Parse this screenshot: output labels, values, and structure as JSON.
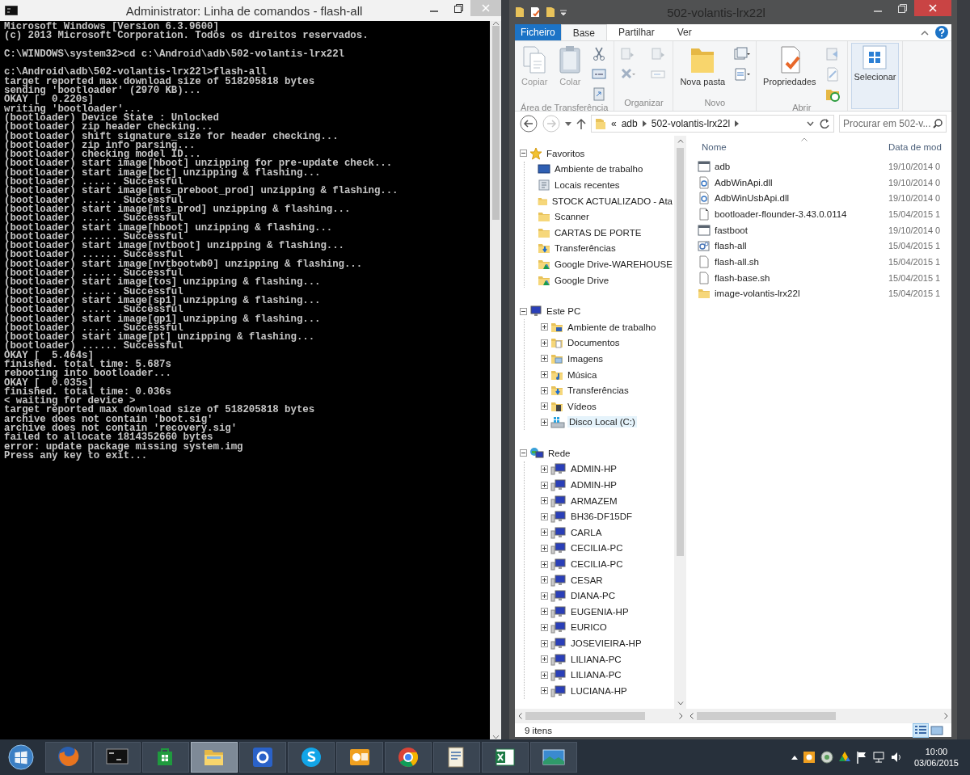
{
  "console": {
    "title": "Administrator: Linha de comandos - flash-all",
    "blocks": [
      [
        "Microsoft Windows [Version 6.3.9600]",
        "(c) 2013 Microsoft Corporation. Todos os direitos reservados."
      ],
      [
        "C:\\WINDOWS\\system32>cd c:\\Android\\adb\\502-volantis-lrx22l"
      ],
      [
        "c:\\Android\\adb\\502-volantis-lrx22l>flash-all",
        "target reported max download size of 518205818 bytes",
        "sending 'bootloader' (2970 KB)...",
        "OKAY [  0.220s]",
        "writing 'bootloader'...",
        "(bootloader) Device State : Unlocked",
        "(bootloader) zip header checking...",
        "(bootloader) shift signature_size for header checking...",
        "(bootloader) zip info parsing...",
        "(bootloader) checking model ID...",
        "(bootloader) start image[hboot] unzipping for pre-update check...",
        "(bootloader) start image[bct] unzipping & flashing...",
        "(bootloader) ...... Successful",
        "(bootloader) start image[mts_preboot_prod] unzipping & flashing...",
        "(bootloader) ...... Successful",
        "(bootloader) start image[mts_prod] unzipping & flashing...",
        "(bootloader) ...... Successful",
        "(bootloader) start image[hboot] unzipping & flashing...",
        "(bootloader) ...... Successful",
        "(bootloader) start image[nvtboot] unzipping & flashing...",
        "(bootloader) ...... Successful",
        "(bootloader) start image[nvtbootwb0] unzipping & flashing...",
        "(bootloader) ...... Successful",
        "(bootloader) start image[tos] unzipping & flashing...",
        "(bootloader) ...... Successful",
        "(bootloader) start image[sp1] unzipping & flashing...",
        "(bootloader) ...... Successful",
        "(bootloader) start image[gp1] unzipping & flashing...",
        "(bootloader) ...... Successful",
        "(bootloader) start image[pt] unzipping & flashing...",
        "(bootloader) ...... Successful",
        "OKAY [  5.464s]",
        "finished. total time: 5.687s",
        "rebooting into bootloader...",
        "OKAY [  0.035s]",
        "finished. total time: 0.036s",
        "< waiting for device >",
        "target reported max download size of 518205818 bytes",
        "archive does not contain 'boot.sig'",
        "archive does not contain 'recovery.sig'",
        "failed to allocate 1814352660 bytes",
        "error: update package missing system.img",
        "Press any key to exit..."
      ]
    ]
  },
  "explorer": {
    "title": "502-volantis-lrx22l",
    "tabs": [
      {
        "label": "Ficheiro",
        "kind": "file",
        "selected": false
      },
      {
        "label": "Base",
        "kind": "tab",
        "selected": true
      },
      {
        "label": "Partilhar",
        "kind": "tab",
        "selected": false
      },
      {
        "label": "Ver",
        "kind": "tab",
        "selected": false
      }
    ],
    "ribbon": [
      {
        "label": "Área de Transferência",
        "buttons": [
          {
            "kind": "large",
            "label": "Copiar",
            "disabled": true
          },
          {
            "kind": "large",
            "label": "Colar",
            "disabled": true
          },
          {
            "kind": "small",
            "disabled": false
          },
          {
            "kind": "small",
            "disabled": false
          },
          {
            "kind": "small",
            "disabled": false
          }
        ]
      },
      {
        "label": "Organizar",
        "buttons": [
          {
            "kind": "small",
            "disabled": true
          },
          {
            "kind": "small",
            "disabled": true
          },
          {
            "kind": "small",
            "disabled": true
          },
          {
            "kind": "small",
            "disabled": true
          }
        ]
      },
      {
        "label": "Novo",
        "buttons": [
          {
            "kind": "large",
            "label": "Nova pasta",
            "disabled": false
          },
          {
            "kind": "small",
            "disabled": false
          },
          {
            "kind": "small",
            "disabled": false
          }
        ]
      },
      {
        "label": "Abrir",
        "buttons": [
          {
            "kind": "large",
            "label": "Propriedades",
            "disabled": false
          },
          {
            "kind": "small",
            "disabled": true
          },
          {
            "kind": "small",
            "disabled": true
          },
          {
            "kind": "small",
            "disabled": false
          }
        ]
      },
      {
        "buttons": [
          {
            "kind": "large",
            "label": "Selecionar",
            "disabled": false,
            "hovered": true
          }
        ]
      }
    ],
    "address": {
      "forward_disabled": true,
      "crumbs": [
        "«",
        "adb",
        "502-volantis-lrx22l"
      ],
      "search": {
        "placeholder": "Procurar em 502-v..."
      }
    },
    "tree": [
      {
        "label": "Favoritos",
        "kind": "star",
        "expanded": true,
        "hovered": false,
        "children": [
          {
            "label": "Ambiente de trabalho",
            "kind": "desktop",
            "hovered": false
          },
          {
            "label": "Locais recentes",
            "kind": "recent",
            "hovered": false
          },
          {
            "label": "STOCK ACTUALIZADO - Ata",
            "kind": "folder",
            "hovered": false
          },
          {
            "label": "Scanner",
            "kind": "folder",
            "hovered": false
          },
          {
            "label": "CARTAS DE PORTE",
            "kind": "folder",
            "hovered": false
          },
          {
            "label": "Transferências",
            "kind": "download",
            "hovered": false
          },
          {
            "label": "Google Drive-WAREHOUSE",
            "kind": "drive-folder",
            "hovered": false
          },
          {
            "label": "Google Drive",
            "kind": "drive-folder",
            "hovered": false
          }
        ]
      },
      {
        "label": "Este PC",
        "kind": "pc",
        "expanded": true,
        "hovered": false,
        "children": [
          {
            "label": "Ambiente de trabalho",
            "kind": "desktop-folder",
            "expanded": false,
            "hovered": false
          },
          {
            "label": "Documentos",
            "kind": "docs",
            "expanded": false,
            "hovered": false
          },
          {
            "label": "Imagens",
            "kind": "pictures",
            "expanded": false,
            "hovered": false
          },
          {
            "label": "Música",
            "kind": "music",
            "expanded": false,
            "hovered": false
          },
          {
            "label": "Transferências",
            "kind": "download",
            "expanded": false,
            "hovered": false
          },
          {
            "label": "Vídeos",
            "kind": "videos",
            "expanded": false,
            "hovered": false
          },
          {
            "label": "Disco Local (C:)",
            "kind": "disk",
            "expanded": false,
            "hovered": true
          }
        ]
      },
      {
        "label": "Rede",
        "kind": "network",
        "expanded": true,
        "hovered": false,
        "children": [
          {
            "label": "ADMIN-HP",
            "kind": "computer",
            "expanded": false,
            "hovered": false
          },
          {
            "label": "ADMIN-HP",
            "kind": "computer",
            "expanded": false,
            "hovered": false
          },
          {
            "label": "ARMAZEM",
            "kind": "computer",
            "expanded": false,
            "hovered": false
          },
          {
            "label": "BH36-DF15DF",
            "kind": "computer",
            "expanded": false,
            "hovered": false
          },
          {
            "label": "CARLA",
            "kind": "computer",
            "expanded": false,
            "hovered": false
          },
          {
            "label": "CECILIA-PC",
            "kind": "computer",
            "expanded": false,
            "hovered": false
          },
          {
            "label": "CECILIA-PC",
            "kind": "computer",
            "expanded": false,
            "hovered": false
          },
          {
            "label": "CESAR",
            "kind": "computer",
            "expanded": false,
            "hovered": false
          },
          {
            "label": "DIANA-PC",
            "kind": "computer",
            "expanded": false,
            "hovered": false
          },
          {
            "label": "EUGENIA-HP",
            "kind": "computer",
            "expanded": false,
            "hovered": false
          },
          {
            "label": "EURICO",
            "kind": "computer",
            "expanded": false,
            "hovered": false
          },
          {
            "label": "JOSEVIEIRA-HP",
            "kind": "computer",
            "expanded": false,
            "hovered": false
          },
          {
            "label": "LILIANA-PC",
            "kind": "computer",
            "expanded": false,
            "hovered": false
          },
          {
            "label": "LILIANA-PC",
            "kind": "computer",
            "expanded": false,
            "hovered": false
          },
          {
            "label": "LUCIANA-HP",
            "kind": "computer",
            "expanded": false,
            "hovered": false
          }
        ]
      }
    ],
    "columns": [
      "Nome",
      "Data de mod"
    ],
    "files": [
      {
        "name": "adb",
        "date": "19/10/2014 0",
        "kind": "app"
      },
      {
        "name": "AdbWinApi.dll",
        "date": "19/10/2014 0",
        "kind": "dll"
      },
      {
        "name": "AdbWinUsbApi.dll",
        "date": "19/10/2014 0",
        "kind": "dll"
      },
      {
        "name": "bootloader-flounder-3.43.0.0114",
        "date": "15/04/2015 1",
        "kind": "image"
      },
      {
        "name": "fastboot",
        "date": "19/10/2014 0",
        "kind": "app"
      },
      {
        "name": "flash-all",
        "date": "15/04/2015 1",
        "kind": "batch"
      },
      {
        "name": "flash-all.sh",
        "date": "15/04/2015 1",
        "kind": "file"
      },
      {
        "name": "flash-base.sh",
        "date": "15/04/2015 1",
        "kind": "file"
      },
      {
        "name": "image-volantis-lrx22l",
        "date": "15/04/2015 1",
        "kind": "folder"
      }
    ],
    "status_bar": {
      "count": "9 itens",
      "views": [
        {
          "kind": "details",
          "selected": true
        },
        {
          "kind": "tiles",
          "selected": false
        }
      ]
    }
  },
  "taskbar": {
    "apps": [
      {
        "kind": "firefox",
        "active": false
      },
      {
        "kind": "console",
        "active": false
      },
      {
        "kind": "store",
        "active": false
      },
      {
        "kind": "explorer",
        "active": true
      },
      {
        "kind": "blue-tile",
        "active": false
      },
      {
        "kind": "skype",
        "active": false
      },
      {
        "kind": "outlook",
        "active": false
      },
      {
        "kind": "chrome",
        "active": false
      },
      {
        "kind": "document",
        "active": false
      },
      {
        "kind": "excel",
        "active": false
      },
      {
        "kind": "photos",
        "active": false
      }
    ],
    "clock": {
      "time": "10:00",
      "date": "03/06/2015"
    }
  }
}
